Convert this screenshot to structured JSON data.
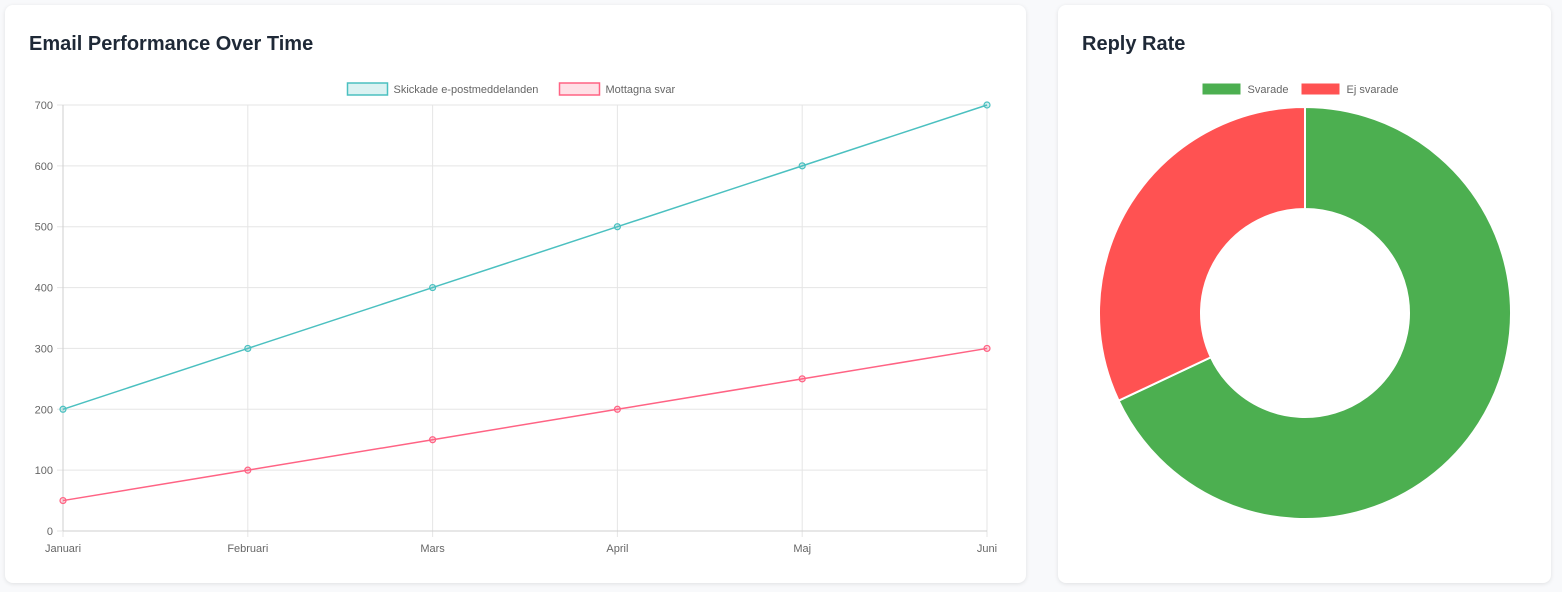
{
  "line_card": {
    "title": "Email Performance Over Time"
  },
  "donut_card": {
    "title": "Reply Rate"
  },
  "colors": {
    "sent_line": "#4bc0c0",
    "replies_line": "#ff6384",
    "answered": "#4caf50",
    "unanswered": "#ff5252",
    "grid": "#e5e5e5"
  },
  "chart_data": [
    {
      "type": "line",
      "title": "Email Performance Over Time",
      "x": [
        "Januari",
        "Februari",
        "Mars",
        "April",
        "Maj",
        "Juni"
      ],
      "series": [
        {
          "name": "Skickade e-postmeddelanden",
          "values": [
            200,
            300,
            400,
            500,
            600,
            700
          ]
        },
        {
          "name": "Mottagna svar",
          "values": [
            50,
            100,
            150,
            200,
            250,
            300
          ]
        }
      ],
      "ylim": [
        0,
        700
      ],
      "yticks": [
        0,
        100,
        200,
        300,
        400,
        500,
        600,
        700
      ],
      "grid": true,
      "legend": "top-center"
    },
    {
      "type": "pie",
      "title": "Reply Rate",
      "donut": true,
      "categories": [
        "Svarade",
        "Ej svarade"
      ],
      "values": [
        68,
        32
      ],
      "legend": "top-center"
    }
  ]
}
